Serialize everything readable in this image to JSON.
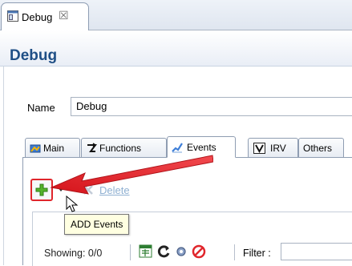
{
  "view_tab": {
    "label": "Debug",
    "close_glyph": "☒",
    "icon": "debug-view-icon"
  },
  "form": {
    "title": "Debug"
  },
  "name_field": {
    "label": "Name",
    "value": "Debug"
  },
  "tabs": [
    {
      "label": "Main",
      "icon": "main-tab-icon",
      "active": false
    },
    {
      "label": "Functions",
      "icon": "functions-tab-icon",
      "active": false
    },
    {
      "label": "Events",
      "icon": "events-tab-icon",
      "active": true
    },
    {
      "label": "IRV",
      "icon": "irv-tab-icon",
      "active": false
    },
    {
      "label": "Others",
      "icon": "others-tab-icon",
      "active": false
    }
  ],
  "events_tab": {
    "add_icon": "green-plus-icon",
    "delete_label": "Delete",
    "tooltip": "ADD Events",
    "showing": "Showing: 0/0",
    "filter_label": "Filter :",
    "filter_value": "",
    "toolbar_icons": [
      "export-icon",
      "refresh-icon",
      "settings-icon",
      "clear-icon"
    ]
  },
  "annotation": {
    "arrow_color": "#e0262c"
  },
  "colors": {
    "title": "#1f4f86",
    "highlight": "#e0262c",
    "add_green": "#54b32c",
    "link_disabled": "#8fb0d2"
  }
}
